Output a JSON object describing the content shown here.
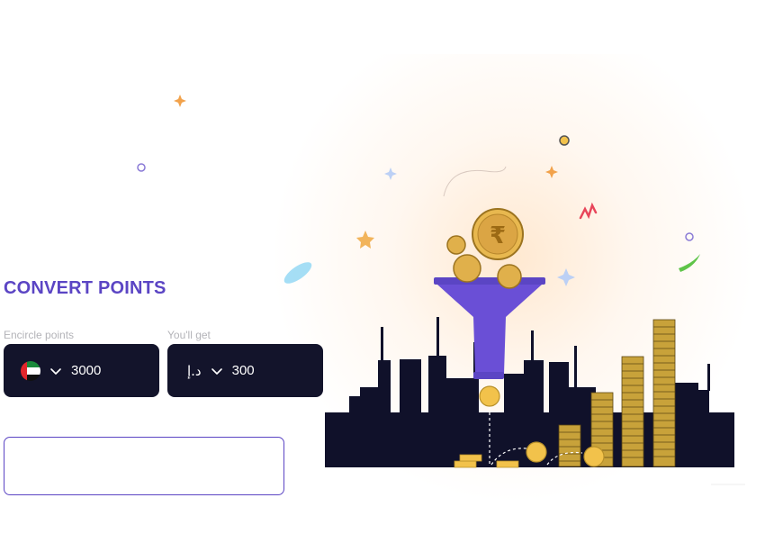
{
  "title": "CONVERT POINTS",
  "from": {
    "label": "Encircle points",
    "currency_icon": "uae-flag-icon",
    "value": "3000"
  },
  "to": {
    "label": "You'll get",
    "currency_symbol": "د.إ",
    "value": "300"
  },
  "colors": {
    "accent": "#5b45c4",
    "panel": "#13142b",
    "coin": "#f2c24b",
    "funnel": "#6a4fd6",
    "city": "#10112a"
  },
  "illustration": {
    "coin_symbol": "₹"
  }
}
